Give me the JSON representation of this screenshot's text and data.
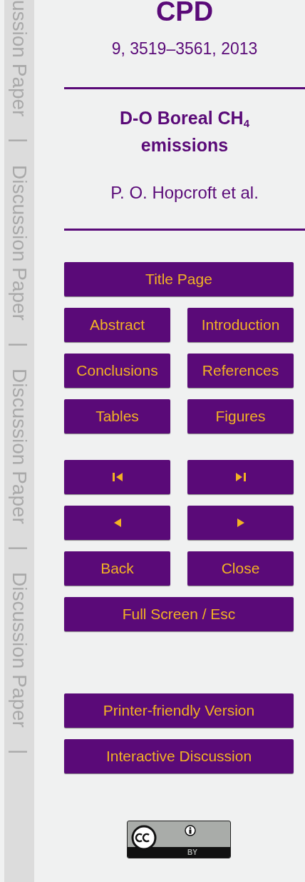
{
  "side_labels": [
    "ussion Paper",
    "|",
    "Discussion Paper",
    "|",
    "Discussion Paper",
    "|",
    "Discussion Paper",
    "|"
  ],
  "header": {
    "journal": "CPD",
    "citation": "9, 3519–3561, 2013",
    "title": "D-O Boreal CH$_{4}$ emissions",
    "authors": "P. O. Hopcroft et al."
  },
  "button_groups": [
    [
      [
        {
          "kind": "text",
          "label": "Title Page"
        }
      ],
      [
        {
          "kind": "text",
          "label": "Abstract"
        },
        {
          "kind": "text",
          "label": "Introduction"
        }
      ],
      [
        {
          "kind": "text",
          "label": "Conclusions"
        },
        {
          "kind": "text",
          "label": "References"
        }
      ],
      [
        {
          "kind": "text",
          "label": "Tables"
        },
        {
          "kind": "text",
          "label": "Figures"
        }
      ]
    ],
    [
      [
        {
          "kind": "first"
        },
        {
          "kind": "last"
        }
      ],
      [
        {
          "kind": "prev"
        },
        {
          "kind": "next"
        }
      ],
      [
        {
          "kind": "text",
          "label": "Back"
        },
        {
          "kind": "text",
          "label": "Close"
        }
      ],
      [
        {
          "kind": "text",
          "label": "Full Screen / Esc"
        }
      ]
    ],
    [
      [
        {
          "kind": "text",
          "label": "Printer-friendly Version"
        }
      ],
      [
        {
          "kind": "text",
          "label": "Interactive Discussion"
        }
      ]
    ]
  ],
  "license_badge": {
    "text": "BY"
  }
}
